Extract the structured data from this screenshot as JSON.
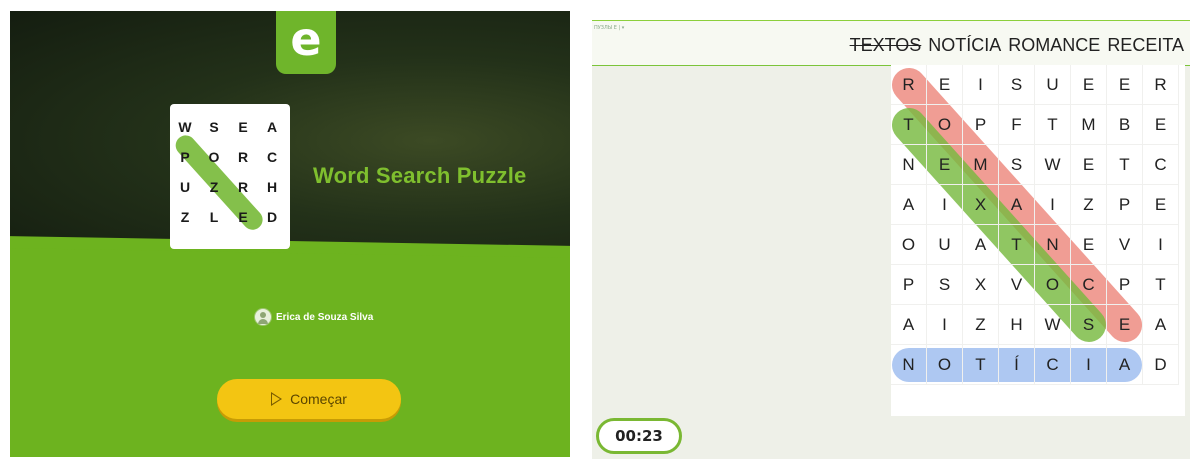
{
  "intro": {
    "logo_letter": "e",
    "title": "Word Search Puzzle",
    "user_name": "Erica de Souza Silva",
    "start_label": "Começar",
    "mini_grid": [
      [
        "W",
        "S",
        "E",
        "A"
      ],
      [
        "P",
        "O",
        "R",
        "C"
      ],
      [
        "U",
        "Z",
        "R",
        "H"
      ],
      [
        "Z",
        "L",
        "E",
        "D"
      ]
    ]
  },
  "game": {
    "header_small": "ПУЗЛЫ Е | ▾",
    "words": [
      {
        "text": "TEXTOS",
        "found": true
      },
      {
        "text": "NOTÍCIA",
        "found": false
      },
      {
        "text": "ROMANCE",
        "found": false
      },
      {
        "text": "RECEITA",
        "found": false
      }
    ],
    "grid": [
      [
        "R",
        "E",
        "I",
        "S",
        "U",
        "E",
        "E",
        "R"
      ],
      [
        "T",
        "O",
        "P",
        "F",
        "T",
        "M",
        "B",
        "E"
      ],
      [
        "N",
        "E",
        "M",
        "S",
        "W",
        "E",
        "T",
        "C"
      ],
      [
        "A",
        "I",
        "X",
        "A",
        "I",
        "Z",
        "P",
        "E"
      ],
      [
        "O",
        "U",
        "A",
        "T",
        "N",
        "E",
        "V",
        "I"
      ],
      [
        "P",
        "S",
        "X",
        "V",
        "O",
        "C",
        "P",
        "T"
      ],
      [
        "A",
        "I",
        "Z",
        "H",
        "W",
        "S",
        "E",
        "A"
      ],
      [
        "N",
        "O",
        "T",
        "Í",
        "C",
        "I",
        "A",
        "D"
      ]
    ],
    "timer": "00:23"
  },
  "colors": {
    "brand_green": "#6db31f",
    "dark_bg": "#1c2814",
    "button_yellow": "#f3c512",
    "highlight_red": "#ec8276",
    "highlight_green": "#78ba40",
    "highlight_blue": "#a0bef0"
  }
}
